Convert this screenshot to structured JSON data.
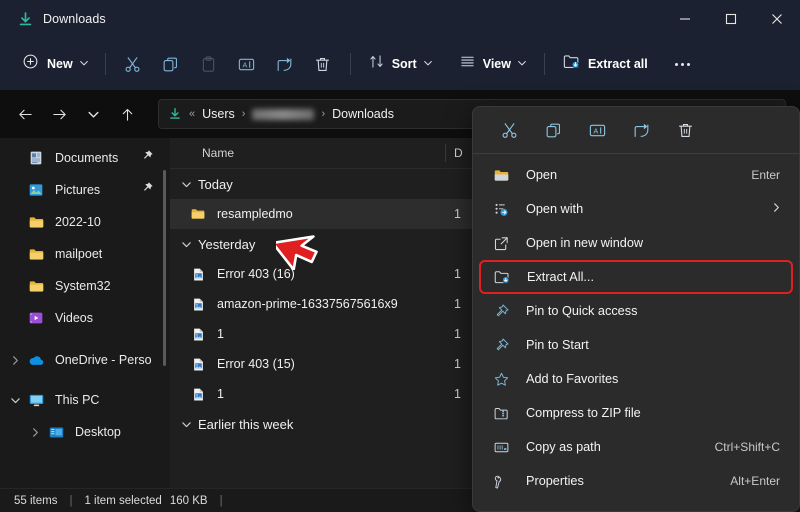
{
  "window": {
    "title": "Downloads",
    "title_icon": "downloads-icon",
    "controls": {
      "minimize": "minimize",
      "maximize": "maximize",
      "close": "close"
    }
  },
  "toolbar": {
    "new_label": "New",
    "icon_buttons": [
      {
        "name": "cut-icon",
        "label": "Cut"
      },
      {
        "name": "copy-icon",
        "label": "Copy"
      },
      {
        "name": "paste-icon",
        "label": "Paste"
      },
      {
        "name": "rename-icon",
        "label": "Rename"
      },
      {
        "name": "share-icon",
        "label": "Share"
      },
      {
        "name": "delete-icon",
        "label": "Delete"
      }
    ],
    "sort_label": "Sort",
    "view_label": "View",
    "extract_all_label": "Extract all",
    "more_label": "See more"
  },
  "address": {
    "root_icon": "downloads-icon",
    "overflow": "«",
    "crumb1": "Users",
    "crumb2_blurred": true,
    "crumb3": "Downloads",
    "sep": "›"
  },
  "sidebar": {
    "items": [
      {
        "label": "Documents",
        "icon": "documents-icon",
        "pinned": true,
        "chevron": "none",
        "indent": 0
      },
      {
        "label": "Pictures",
        "icon": "pictures-icon",
        "pinned": true,
        "chevron": "none",
        "indent": 0
      },
      {
        "label": "2022-10",
        "icon": "folder-icon",
        "pinned": false,
        "chevron": "none",
        "indent": 0
      },
      {
        "label": "mailpoet",
        "icon": "folder-icon",
        "pinned": false,
        "chevron": "none",
        "indent": 0
      },
      {
        "label": "System32",
        "icon": "folder-icon",
        "pinned": false,
        "chevron": "none",
        "indent": 0
      },
      {
        "label": "Videos",
        "icon": "videos-icon",
        "pinned": false,
        "chevron": "none",
        "indent": 0
      },
      {
        "label": "OneDrive - Perso",
        "icon": "onedrive-icon",
        "pinned": false,
        "chevron": "right",
        "indent": 0
      },
      {
        "label": "This PC",
        "icon": "thispc-icon",
        "pinned": false,
        "chevron": "down",
        "indent": 0
      },
      {
        "label": "Desktop",
        "icon": "desktop-icon",
        "pinned": false,
        "chevron": "right",
        "indent": 1
      }
    ]
  },
  "filelist": {
    "columns": {
      "name": "Name",
      "date": "D"
    },
    "groups": [
      {
        "label": "Today",
        "expanded": true,
        "rows": [
          {
            "name": "resampledmo",
            "icon": "folder-icon",
            "date": "1",
            "selected": true
          }
        ]
      },
      {
        "label": "Yesterday",
        "expanded": true,
        "rows": [
          {
            "name": "Error 403 (16)",
            "icon": "image-file-icon",
            "date": "1",
            "selected": false
          },
          {
            "name": "amazon-prime-163375675616x9",
            "icon": "image-file-icon",
            "date": "1",
            "selected": false
          },
          {
            "name": "1",
            "icon": "image-file-icon",
            "date": "1",
            "selected": false
          },
          {
            "name": "Error 403 (15)",
            "icon": "image-file-icon",
            "date": "1",
            "selected": false
          },
          {
            "name": "1",
            "icon": "image-file-icon",
            "date": "1",
            "selected": false
          }
        ]
      },
      {
        "label": "Earlier this week",
        "expanded": true,
        "rows": []
      }
    ]
  },
  "statusbar": {
    "items_count": "55 items",
    "separator": "|",
    "selection": "1 item selected",
    "size": "160 KB",
    "separator2": "|"
  },
  "contextmenu": {
    "icon_row": [
      {
        "name": "cut-icon",
        "label": "Cut"
      },
      {
        "name": "copy-icon",
        "label": "Copy"
      },
      {
        "name": "rename-icon",
        "label": "Rename"
      },
      {
        "name": "share-icon",
        "label": "Share"
      },
      {
        "name": "delete-icon",
        "label": "Delete"
      }
    ],
    "items": [
      {
        "label": "Open",
        "icon": "folder-open-icon",
        "accel": "Enter",
        "submenu": false,
        "highlighted": false
      },
      {
        "label": "Open with",
        "icon": "open-with-icon",
        "accel": "",
        "submenu": true,
        "highlighted": false
      },
      {
        "label": "Open in new window",
        "icon": "new-window-icon",
        "accel": "",
        "submenu": false,
        "highlighted": false
      },
      {
        "label": "Extract All...",
        "icon": "extract-icon",
        "accel": "",
        "submenu": false,
        "highlighted": true
      },
      {
        "label": "Pin to Quick access",
        "icon": "pin-icon",
        "accel": "",
        "submenu": false,
        "highlighted": false
      },
      {
        "label": "Pin to Start",
        "icon": "pin-icon",
        "accel": "",
        "submenu": false,
        "highlighted": false
      },
      {
        "label": "Add to Favorites",
        "icon": "star-icon",
        "accel": "",
        "submenu": false,
        "highlighted": false
      },
      {
        "label": "Compress to ZIP file",
        "icon": "zip-icon",
        "accel": "",
        "submenu": false,
        "highlighted": false
      },
      {
        "label": "Copy as path",
        "icon": "copy-path-icon",
        "accel": "Ctrl+Shift+C",
        "submenu": false,
        "highlighted": false
      },
      {
        "label": "Properties",
        "icon": "properties-icon",
        "accel": "Alt+Enter",
        "submenu": false,
        "highlighted": false
      }
    ]
  },
  "annotations": {
    "highlight_color": "#e02020",
    "cursor": "red-arrow-pointer"
  },
  "colors": {
    "titlebar_bg": "#1b2130",
    "toolbar_bg": "#1b2130",
    "address_bg": "#0e0e0e",
    "sidebar_bg": "#1a1a1a",
    "filelist_bg": "#1f1f1f",
    "menu_bg": "#2b2b2b",
    "accent": "#4cc2ff",
    "folder": "#e8b339",
    "highlight": "#e02020"
  }
}
